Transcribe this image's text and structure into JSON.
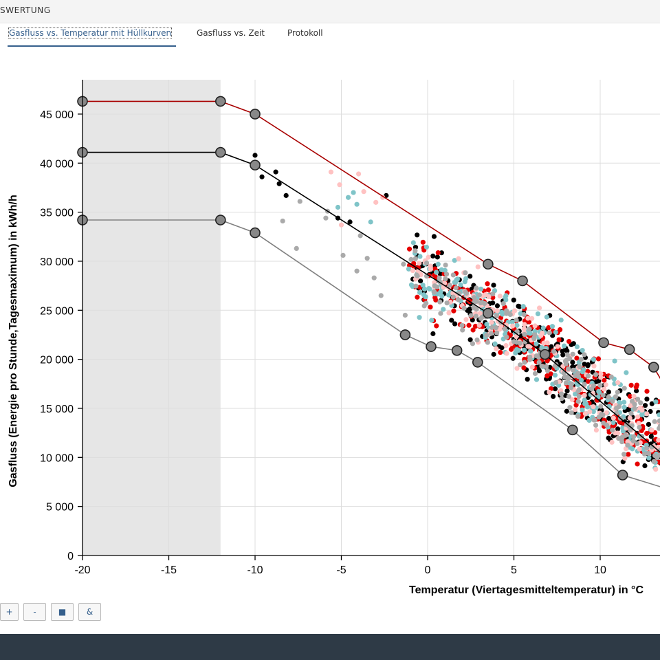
{
  "header": {
    "title": "SWERTUNG"
  },
  "tabs": [
    {
      "label": "Gasfluss vs. Temperatur mit Hüllkurven",
      "active": true
    },
    {
      "label": "Gasfluss vs. Zeit",
      "active": false
    },
    {
      "label": "Protokoll",
      "active": false
    }
  ],
  "controls": [
    {
      "label": "+",
      "name": "zoom-in-button"
    },
    {
      "label": "-",
      "name": "zoom-out-button"
    },
    {
      "label": "■",
      "name": "reset-view-button"
    },
    {
      "label": "&",
      "name": "combine-button"
    }
  ],
  "chart_data": {
    "type": "scatter",
    "xlabel": "Temperatur (Viertagesmitteltemperatur) in °C",
    "ylabel": "Gasfluss (Energie pro Stunde,Tagesmaximum) in kWh/h",
    "xlim": [
      -20,
      13.5
    ],
    "ylim": [
      0,
      48500
    ],
    "x_ticks": [
      -20,
      -15,
      -10,
      -5,
      0,
      5,
      10
    ],
    "x_tick_labels": [
      "-20",
      "-15",
      "-10",
      "-5",
      "0",
      "5",
      "10"
    ],
    "y_ticks": [
      0,
      5000,
      10000,
      15000,
      20000,
      25000,
      30000,
      35000,
      40000,
      45000
    ],
    "y_tick_labels": [
      "0",
      "5 000",
      "10 000",
      "15 000",
      "20 000",
      "25 000",
      "30 000",
      "35 000",
      "40 000",
      "45 000"
    ],
    "grid": true,
    "shaded_region": {
      "x": [
        -20,
        -12
      ],
      "color": "#e6e6e6"
    },
    "envelopes": [
      {
        "color": "#a80000",
        "points": [
          [
            -20,
            46300
          ],
          [
            -12,
            46300
          ],
          [
            -10,
            45000
          ],
          [
            3.5,
            29700
          ],
          [
            5.5,
            28000
          ],
          [
            10.2,
            21700
          ],
          [
            11.7,
            21000
          ],
          [
            13.1,
            19200
          ],
          [
            13.5,
            18000
          ]
        ]
      },
      {
        "color": "#000000",
        "points": [
          [
            -20,
            41100
          ],
          [
            -12,
            41100
          ],
          [
            -10,
            39800
          ],
          [
            3.5,
            24700
          ],
          [
            6.8,
            20500
          ],
          [
            13.5,
            10500
          ]
        ]
      },
      {
        "color": "#808080",
        "points": [
          [
            -20,
            34200
          ],
          [
            -12,
            34200
          ],
          [
            -10,
            32900
          ],
          [
            -1.3,
            22500
          ],
          [
            0.2,
            21300
          ],
          [
            1.7,
            20900
          ],
          [
            2.9,
            19700
          ],
          [
            8.4,
            12800
          ],
          [
            11.3,
            8200
          ],
          [
            13.5,
            7000
          ]
        ]
      }
    ],
    "scatter_series": [
      {
        "color": "#000000",
        "seed": 11,
        "count": 300,
        "extra": [
          [
            -10,
            40800
          ],
          [
            -9.6,
            38600
          ],
          [
            -8.8,
            39100
          ],
          [
            -8.6,
            37900
          ],
          [
            -8.2,
            36700
          ],
          [
            -5.2,
            34400
          ],
          [
            -4.5,
            34000
          ],
          [
            -2.4,
            36700
          ]
        ]
      },
      {
        "color": "#e60000",
        "seed": 23,
        "count": 250,
        "extra": []
      },
      {
        "color": "#7fc4c8",
        "seed": 37,
        "count": 200,
        "extra": [
          [
            -4.6,
            36500
          ],
          [
            -4.3,
            37000
          ],
          [
            -4.1,
            35800
          ],
          [
            -3.3,
            34000
          ],
          [
            -5.2,
            35500
          ]
        ]
      },
      {
        "color": "#ffc2c2",
        "seed": 41,
        "count": 160,
        "extra": [
          [
            -5.6,
            39100
          ],
          [
            -4.0,
            38900
          ],
          [
            -5.1,
            37800
          ],
          [
            -3.7,
            37100
          ],
          [
            -3.0,
            36000
          ],
          [
            -2.6,
            36500
          ],
          [
            -5.0,
            33700
          ]
        ]
      },
      {
        "color": "#aaaaaa",
        "seed": 53,
        "count": 190,
        "extra": [
          [
            -8.4,
            34100
          ],
          [
            -7.4,
            36100
          ],
          [
            -7.6,
            31300
          ],
          [
            -5.8,
            35100
          ],
          [
            -5.9,
            34400
          ],
          [
            -4.9,
            30600
          ],
          [
            -4.1,
            29000
          ],
          [
            -3.9,
            32600
          ],
          [
            -3.5,
            30300
          ],
          [
            -3.1,
            28300
          ],
          [
            -2.7,
            26500
          ],
          [
            -1.3,
            24500
          ],
          [
            -1.4,
            29700
          ]
        ]
      }
    ]
  }
}
